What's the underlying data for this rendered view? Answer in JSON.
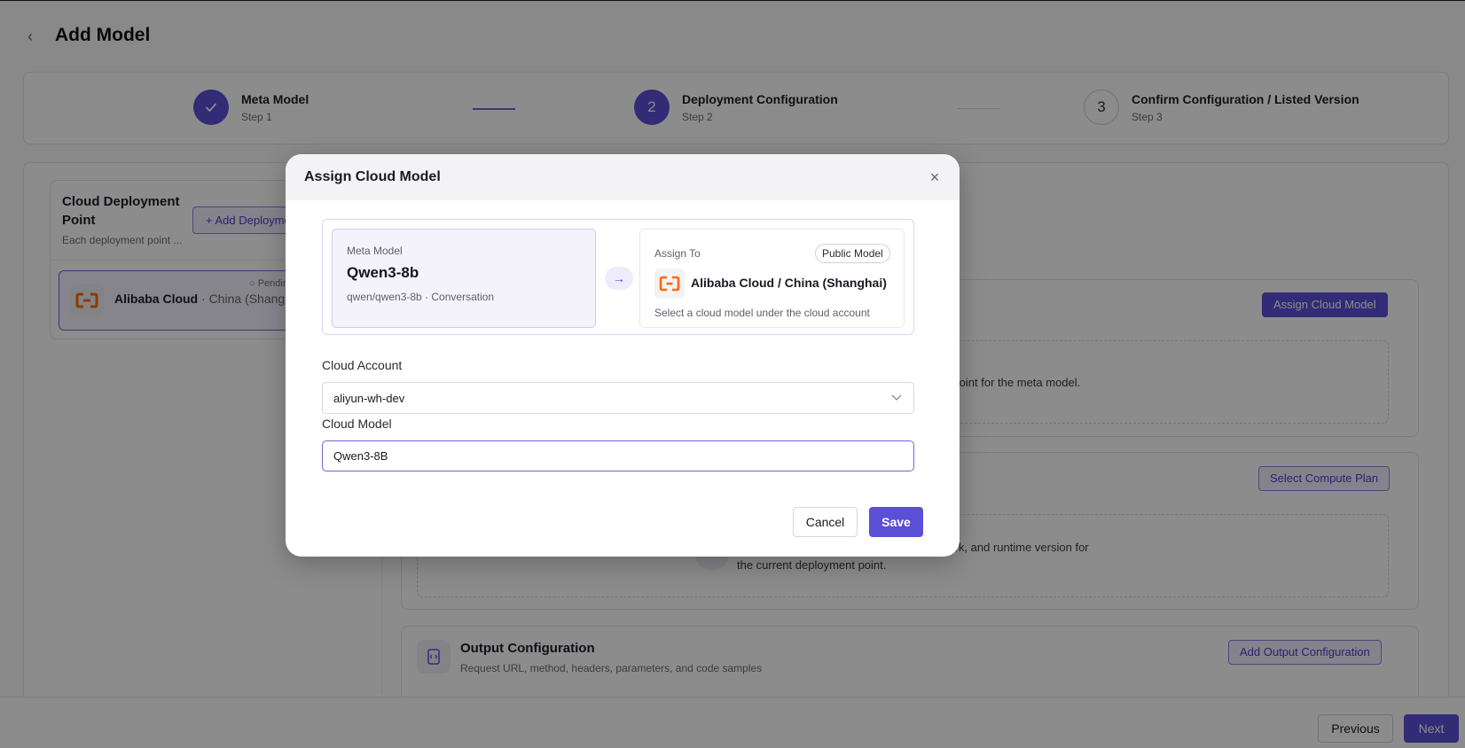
{
  "page": {
    "title": "Add Model",
    "steps": [
      {
        "label": "Meta Model",
        "sub": "Step 1",
        "state": "done",
        "number": "1"
      },
      {
        "label": "Deployment Configuration",
        "sub": "Step 2",
        "state": "active",
        "number": "2"
      },
      {
        "label": "Confirm Configuration / Listed Version",
        "sub": "Step 3",
        "state": "todo",
        "number": "3"
      }
    ],
    "left_panel": {
      "title": "Cloud Deployment Point",
      "description": "Each deployment point ...",
      "add_button": "+ Add Deployment Point",
      "item": {
        "provider": "Alibaba Cloud",
        "region": " · China (Shanghai)",
        "status": "○ Pending"
      }
    },
    "sections": {
      "assign_button": "Assign Cloud Model",
      "assign_hint": "nt point for the meta model.",
      "compute_button": "Select Compute Plan",
      "compute_hint_1": "work, and runtime version for",
      "compute_hint_2": "the current deployment point.",
      "output_title": "Output Configuration",
      "output_desc": "Request URL, method, headers, parameters, and code samples",
      "output_button": "Add Output Configuration"
    },
    "footer": {
      "previous": "Previous",
      "next": "Next"
    }
  },
  "modal": {
    "title": "Assign Cloud Model",
    "close_glyph": "×",
    "meta": {
      "label": "Meta Model",
      "name": "Qwen3-8b",
      "sub": "qwen/qwen3-8b · Conversation"
    },
    "arrow_glyph": "→",
    "assign": {
      "label": "Assign To",
      "badge": "Public Model",
      "target": "Alibaba Cloud / China (Shanghai)",
      "desc": "Select a cloud model under the cloud account"
    },
    "cloud_account": {
      "label": "Cloud Account",
      "value": "aliyun-wh-dev"
    },
    "cloud_model": {
      "label": "Cloud Model",
      "value": "Qwen3-8B"
    },
    "buttons": {
      "cancel": "Cancel",
      "save": "Save"
    }
  },
  "icons": {
    "back": "chevron-left-icon",
    "check": "check-icon",
    "close": "close-icon",
    "arrow": "arrow-right-icon",
    "chevron_down": "chevron-down-icon",
    "cloud_logo": "alibaba-cloud-logo-icon"
  },
  "colors": {
    "accent": "#5b4fd8",
    "alibaba_orange": "#ff6a00",
    "overlay": "rgba(0,0,0,0.45)"
  }
}
